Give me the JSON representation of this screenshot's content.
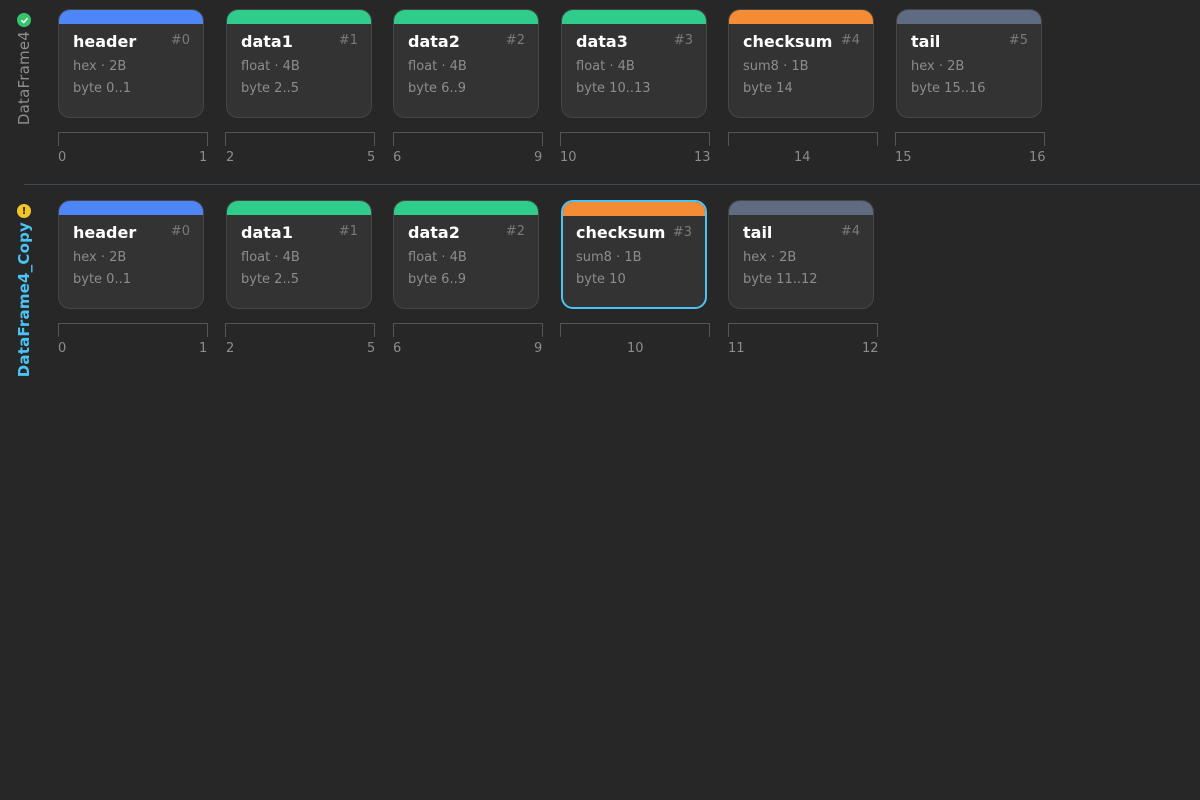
{
  "colors": {
    "header": "#4f86f7",
    "data": "#2fcc8b",
    "checksum": "#f48b35",
    "tail": "#5f6b80",
    "selected": "#4cc3f5"
  },
  "frames": [
    {
      "name": "DataFrame4",
      "status_icon": "check-circle-icon",
      "fields": [
        {
          "title": "header",
          "index": "#0",
          "type": "hex · 2B",
          "range": "byte 0..1",
          "color_key": "header",
          "start": "0",
          "end": "1"
        },
        {
          "title": "data1",
          "index": "#1",
          "type": "float · 4B",
          "range": "byte 2..5",
          "color_key": "data",
          "start": "2",
          "end": "5"
        },
        {
          "title": "data2",
          "index": "#2",
          "type": "float · 4B",
          "range": "byte 6..9",
          "color_key": "data",
          "start": "6",
          "end": "9"
        },
        {
          "title": "data3",
          "index": "#3",
          "type": "float · 4B",
          "range": "byte 10..13",
          "color_key": "data",
          "start": "10",
          "end": "13"
        },
        {
          "title": "checksum",
          "index": "#4",
          "type": "sum8 · 1B",
          "range": "byte 14",
          "color_key": "checksum",
          "single": "14"
        },
        {
          "title": "tail",
          "index": "#5",
          "type": "hex · 2B",
          "range": "byte 15..16",
          "color_key": "tail",
          "start": "15",
          "end": "16"
        }
      ]
    },
    {
      "name": "DataFrame4_Copy",
      "status_icon": "warning-circle-icon",
      "fields": [
        {
          "title": "header",
          "index": "#0",
          "type": "hex · 2B",
          "range": "byte 0..1",
          "color_key": "header",
          "start": "0",
          "end": "1"
        },
        {
          "title": "data1",
          "index": "#1",
          "type": "float · 4B",
          "range": "byte 2..5",
          "color_key": "data",
          "start": "2",
          "end": "5"
        },
        {
          "title": "data2",
          "index": "#2",
          "type": "float · 4B",
          "range": "byte 6..9",
          "color_key": "data",
          "start": "6",
          "end": "9"
        },
        {
          "title": "checksum",
          "index": "#3",
          "type": "sum8 · 1B",
          "range": "byte 10",
          "color_key": "checksum",
          "single": "10",
          "selected": true
        },
        {
          "title": "tail",
          "index": "#4",
          "type": "hex · 2B",
          "range": "byte 11..12",
          "color_key": "tail",
          "start": "11",
          "end": "12"
        }
      ]
    }
  ]
}
